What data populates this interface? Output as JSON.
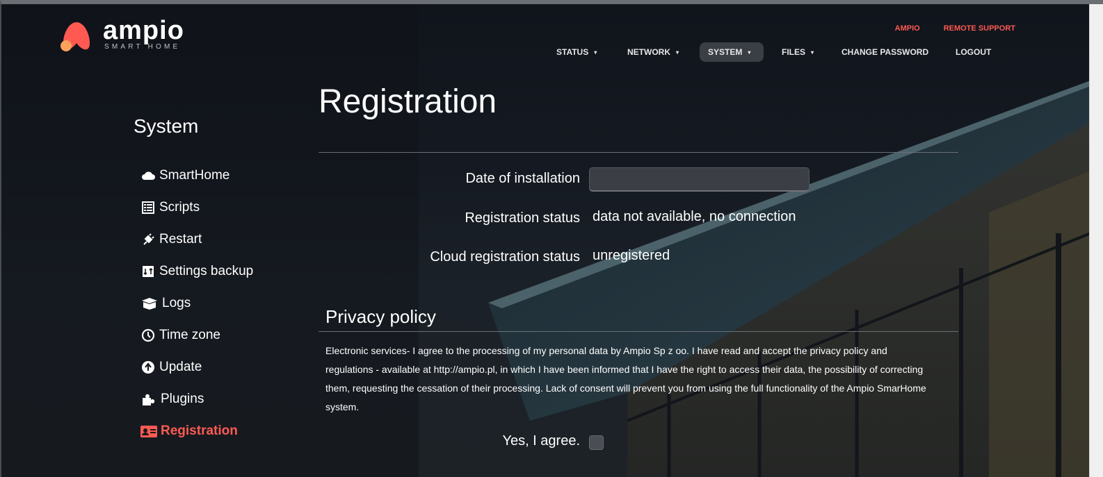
{
  "brand": {
    "logo_word": "ampio",
    "logo_tagline": "SMART HOME",
    "accent_color": "#ff5a52"
  },
  "top_links": [
    {
      "label": "AMPIO"
    },
    {
      "label": "REMOTE SUPPORT"
    }
  ],
  "nav": [
    {
      "label": "STATUS",
      "caret": "▾",
      "active": false
    },
    {
      "label": "NETWORK",
      "caret": "▾",
      "active": false
    },
    {
      "label": "SYSTEM",
      "caret": "▾",
      "active": true
    },
    {
      "label": "FILES",
      "caret": "▾",
      "active": false
    },
    {
      "label": "CHANGE PASSWORD",
      "active": false
    },
    {
      "label": "LOGOUT",
      "active": false
    }
  ],
  "sidebar": {
    "title": "System",
    "items": [
      {
        "label": "SmartHome",
        "icon": "cloud-icon"
      },
      {
        "label": "Scripts",
        "icon": "list-icon"
      },
      {
        "label": "Restart",
        "icon": "plug-icon"
      },
      {
        "label": "Settings backup",
        "icon": "backup-icon"
      },
      {
        "label": "Logs",
        "icon": "box-icon"
      },
      {
        "label": "Time zone",
        "icon": "clock-icon"
      },
      {
        "label": "Update",
        "icon": "upload-icon"
      },
      {
        "label": "Plugins",
        "icon": "puzzle-icon"
      },
      {
        "label": "Registration",
        "icon": "id-card-icon",
        "active": true
      }
    ]
  },
  "main": {
    "title": "Registration",
    "fields": {
      "date_label": "Date of installation",
      "date_value": "",
      "reg_status_label": "Registration status",
      "reg_status_value": "data not available, no connection",
      "cloud_status_label": "Cloud registration status",
      "cloud_status_value": "unregistered"
    },
    "privacy": {
      "title": "Privacy policy",
      "text": "Electronic services- I agree to the processing of my personal data by Ampio Sp z oo. I have read and accept the privacy policy and regulations - available at http://ampio.pl, in which I have been informed that I have the right to access their data, the possibility of correcting them, requesting the cessation of their processing. Lack of consent will prevent you from using the full functionality of the Ampio SmarHome system.",
      "agree_label": "Yes, I agree.",
      "agree_checked": false
    }
  }
}
